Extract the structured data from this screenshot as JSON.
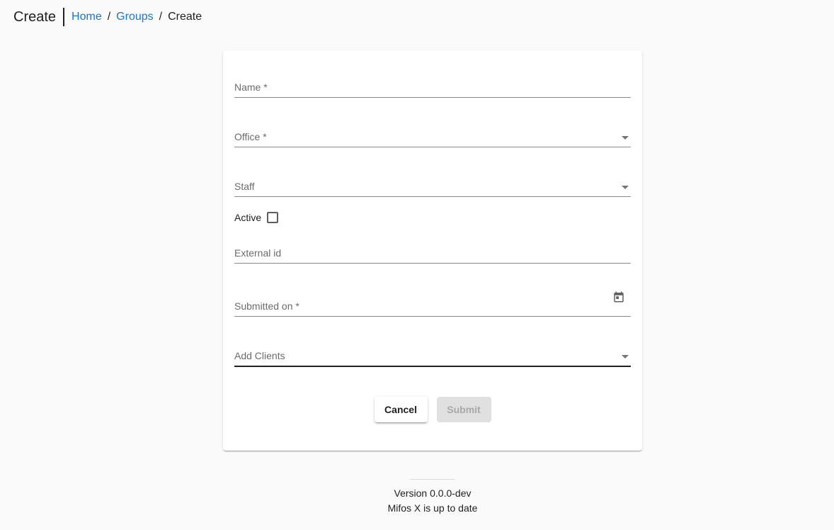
{
  "header": {
    "title": "Create",
    "breadcrumb": {
      "home": "Home",
      "groups": "Groups",
      "current": "Create",
      "separator": "/"
    }
  },
  "form": {
    "name_label": "Name *",
    "office_label": "Office *",
    "staff_label": "Staff",
    "active_label": "Active",
    "active_checked": false,
    "external_id_label": "External id",
    "submitted_on_label": "Submitted on *",
    "add_clients_label": "Add Clients",
    "cancel_label": "Cancel",
    "submit_label": "Submit",
    "calendar_icon": "calendar-icon",
    "dropdown_icon": "arrow-drop-down-icon"
  },
  "footer": {
    "version": "Version 0.0.0-dev",
    "status": "Mifos X is up to date"
  },
  "colors": {
    "link": "#1976d2",
    "background": "#fafafa",
    "disabled_button": "#e0e0e0"
  }
}
